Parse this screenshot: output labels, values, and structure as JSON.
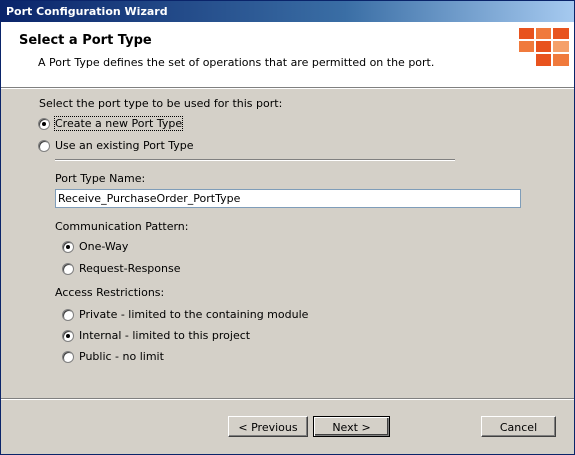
{
  "window": {
    "title": "Port Configuration Wizard"
  },
  "header": {
    "title": "Select a Port Type",
    "description": "A Port Type defines the set of operations that are permitted on the port.",
    "logo": "wizard-logo-icon"
  },
  "port_type_prompt": "Select the port type to be used for this port:",
  "port_type_options": [
    {
      "label": "Create a new Port Type",
      "selected": true
    },
    {
      "label": "Use an existing Port Type",
      "selected": false
    }
  ],
  "port_type_name": {
    "label": "Port Type Name:",
    "value": "Receive_PurchaseOrder_PortType"
  },
  "communication_pattern": {
    "label": "Communication Pattern:",
    "options": [
      {
        "label": "One-Way",
        "selected": true
      },
      {
        "label": "Request-Response",
        "selected": false
      }
    ]
  },
  "access_restrictions": {
    "label": "Access Restrictions:",
    "options": [
      {
        "label": "Private - limited to the containing module",
        "selected": false
      },
      {
        "label": "Internal - limited to this project",
        "selected": true
      },
      {
        "label": "Public - no limit",
        "selected": false
      }
    ]
  },
  "buttons": {
    "previous": "< Previous",
    "next": "Next >",
    "cancel": "Cancel"
  },
  "colors": {
    "accent": "#e8531e",
    "titlebar": "#0a246a",
    "face": "#d4d0c8"
  }
}
